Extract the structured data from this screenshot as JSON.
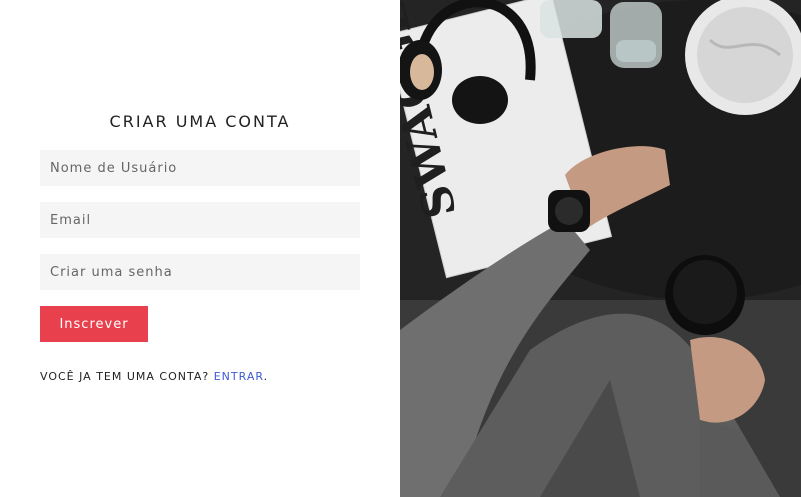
{
  "form": {
    "title": "CRIAR UMA CONTA",
    "username_placeholder": "Nome de Usuário",
    "email_placeholder": "Email",
    "password_placeholder": "Criar uma senha",
    "submit_label": "Inscrever",
    "signin_prompt": "VOCÊ JA TEM UMA CONTA?",
    "signin_link": "ENTRAR",
    "signin_suffix": "."
  },
  "hero": {
    "magazine_text": "SWAGGER"
  },
  "colors": {
    "accent": "#e8414d",
    "link": "#3b5bd6",
    "field_bg": "#f5f5f5"
  }
}
